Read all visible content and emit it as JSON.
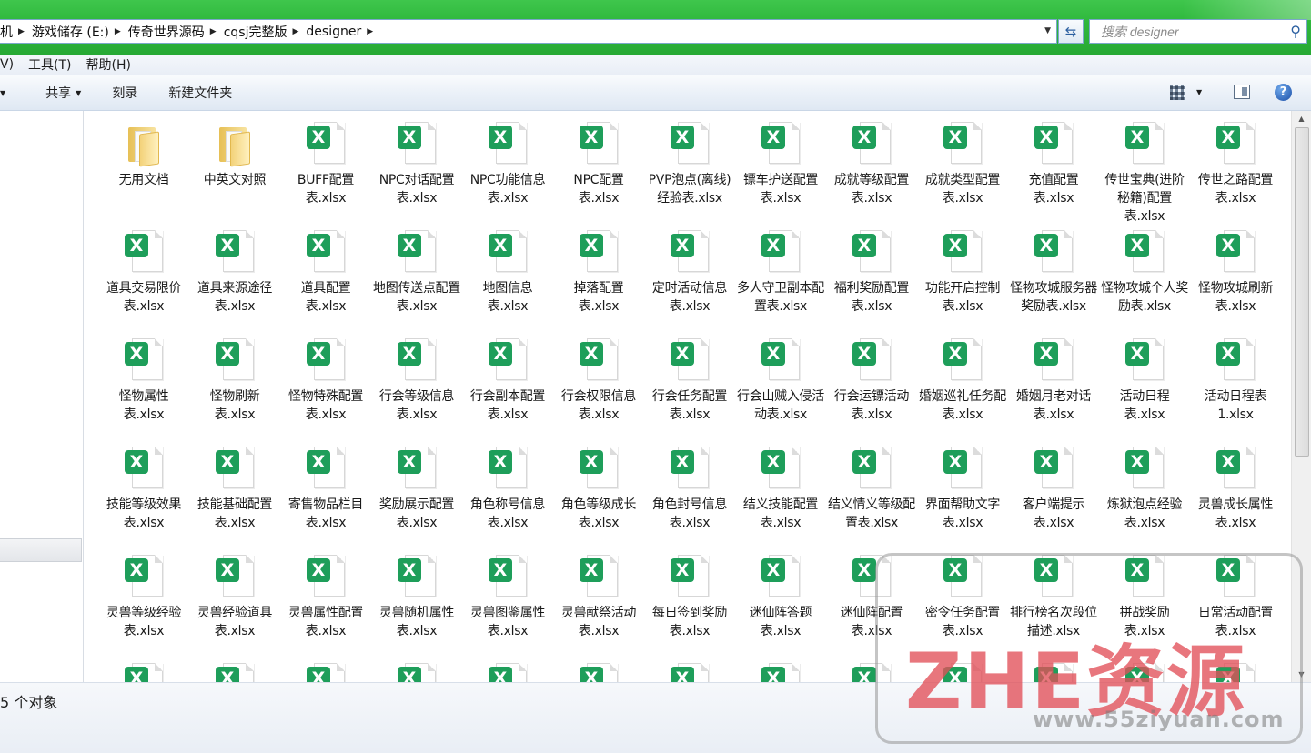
{
  "address": {
    "crumbs": [
      "机",
      "游戏储存 (E:)",
      "传奇世界源码",
      "cqsj完整版",
      "designer"
    ]
  },
  "search": {
    "placeholder": "搜索 designer"
  },
  "menu": {
    "items": [
      "V)",
      "工具(T)",
      "帮助(H)"
    ]
  },
  "toolbar": {
    "share_label": "共享",
    "burn_label": "刻录",
    "new_folder_label": "新建文件夹"
  },
  "status": {
    "text": "5 个对象"
  },
  "watermark": {
    "text": "ZHE资源",
    "url": "www.55ziyuan.com"
  },
  "files": [
    {
      "name": "无用文档",
      "type": "folder"
    },
    {
      "name": "中英文对照",
      "type": "folder"
    },
    {
      "name": "BUFF配置表.xlsx",
      "type": "xlsx"
    },
    {
      "name": "NPC对话配置表.xlsx",
      "type": "xlsx"
    },
    {
      "name": "NPC功能信息表.xlsx",
      "type": "xlsx"
    },
    {
      "name": "NPC配置表.xlsx",
      "type": "xlsx"
    },
    {
      "name": "PVP泡点(离线)经验表.xlsx",
      "type": "xlsx"
    },
    {
      "name": "镖车护送配置表.xlsx",
      "type": "xlsx"
    },
    {
      "name": "成就等级配置表.xlsx",
      "type": "xlsx"
    },
    {
      "name": "成就类型配置表.xlsx",
      "type": "xlsx"
    },
    {
      "name": "充值配置表.xlsx",
      "type": "xlsx"
    },
    {
      "name": "传世宝典(进阶秘籍)配置表.xlsx",
      "type": "xlsx"
    },
    {
      "name": "传世之路配置表.xlsx",
      "type": "xlsx"
    },
    {
      "name": "道具交易限价表.xlsx",
      "type": "xlsx"
    },
    {
      "name": "道具来源途径表.xlsx",
      "type": "xlsx"
    },
    {
      "name": "道具配置表.xlsx",
      "type": "xlsx"
    },
    {
      "name": "地图传送点配置表.xlsx",
      "type": "xlsx"
    },
    {
      "name": "地图信息表.xlsx",
      "type": "xlsx"
    },
    {
      "name": "掉落配置表.xlsx",
      "type": "xlsx"
    },
    {
      "name": "定时活动信息表.xlsx",
      "type": "xlsx"
    },
    {
      "name": "多人守卫副本配置表.xlsx",
      "type": "xlsx"
    },
    {
      "name": "福利奖励配置表.xlsx",
      "type": "xlsx"
    },
    {
      "name": "功能开启控制表.xlsx",
      "type": "xlsx"
    },
    {
      "name": "怪物攻城服务器奖励表.xlsx",
      "type": "xlsx"
    },
    {
      "name": "怪物攻城个人奖励表.xlsx",
      "type": "xlsx"
    },
    {
      "name": "怪物攻城刷新表.xlsx",
      "type": "xlsx"
    },
    {
      "name": "怪物属性表.xlsx",
      "type": "xlsx"
    },
    {
      "name": "怪物刷新表.xlsx",
      "type": "xlsx"
    },
    {
      "name": "怪物特殊配置表.xlsx",
      "type": "xlsx"
    },
    {
      "name": "行会等级信息表.xlsx",
      "type": "xlsx"
    },
    {
      "name": "行会副本配置表.xlsx",
      "type": "xlsx"
    },
    {
      "name": "行会权限信息表.xlsx",
      "type": "xlsx"
    },
    {
      "name": "行会任务配置表.xlsx",
      "type": "xlsx"
    },
    {
      "name": "行会山贼入侵活动表.xlsx",
      "type": "xlsx"
    },
    {
      "name": "行会运镖活动表.xlsx",
      "type": "xlsx"
    },
    {
      "name": "婚姻巡礼任务配表.xlsx",
      "type": "xlsx"
    },
    {
      "name": "婚姻月老对话表.xlsx",
      "type": "xlsx"
    },
    {
      "name": "活动日程表.xlsx",
      "type": "xlsx"
    },
    {
      "name": "活动日程表1.xlsx",
      "type": "xlsx"
    },
    {
      "name": "技能等级效果表.xlsx",
      "type": "xlsx"
    },
    {
      "name": "技能基础配置表.xlsx",
      "type": "xlsx"
    },
    {
      "name": "寄售物品栏目表.xlsx",
      "type": "xlsx"
    },
    {
      "name": "奖励展示配置表.xlsx",
      "type": "xlsx"
    },
    {
      "name": "角色称号信息表.xlsx",
      "type": "xlsx"
    },
    {
      "name": "角色等级成长表.xlsx",
      "type": "xlsx"
    },
    {
      "name": "角色封号信息表.xlsx",
      "type": "xlsx"
    },
    {
      "name": "结义技能配置表.xlsx",
      "type": "xlsx"
    },
    {
      "name": "结义情义等级配置表.xlsx",
      "type": "xlsx"
    },
    {
      "name": "界面帮助文字表.xlsx",
      "type": "xlsx"
    },
    {
      "name": "客户端提示表.xlsx",
      "type": "xlsx"
    },
    {
      "name": "炼狱泡点经验表.xlsx",
      "type": "xlsx"
    },
    {
      "name": "灵兽成长属性表.xlsx",
      "type": "xlsx"
    },
    {
      "name": "灵兽等级经验表.xlsx",
      "type": "xlsx"
    },
    {
      "name": "灵兽经验道具表.xlsx",
      "type": "xlsx"
    },
    {
      "name": "灵兽属性配置表.xlsx",
      "type": "xlsx"
    },
    {
      "name": "灵兽随机属性表.xlsx",
      "type": "xlsx"
    },
    {
      "name": "灵兽图鉴属性表.xlsx",
      "type": "xlsx"
    },
    {
      "name": "灵兽献祭活动表.xlsx",
      "type": "xlsx"
    },
    {
      "name": "每日签到奖励表.xlsx",
      "type": "xlsx"
    },
    {
      "name": "迷仙阵答题表.xlsx",
      "type": "xlsx"
    },
    {
      "name": "迷仙阵配置表.xlsx",
      "type": "xlsx"
    },
    {
      "name": "密令任务配置表.xlsx",
      "type": "xlsx"
    },
    {
      "name": "排行榜名次段位描述.xlsx",
      "type": "xlsx"
    },
    {
      "name": "拼战奖励表.xlsx",
      "type": "xlsx"
    },
    {
      "name": "日常活动配置表.xlsx",
      "type": "xlsx"
    }
  ]
}
